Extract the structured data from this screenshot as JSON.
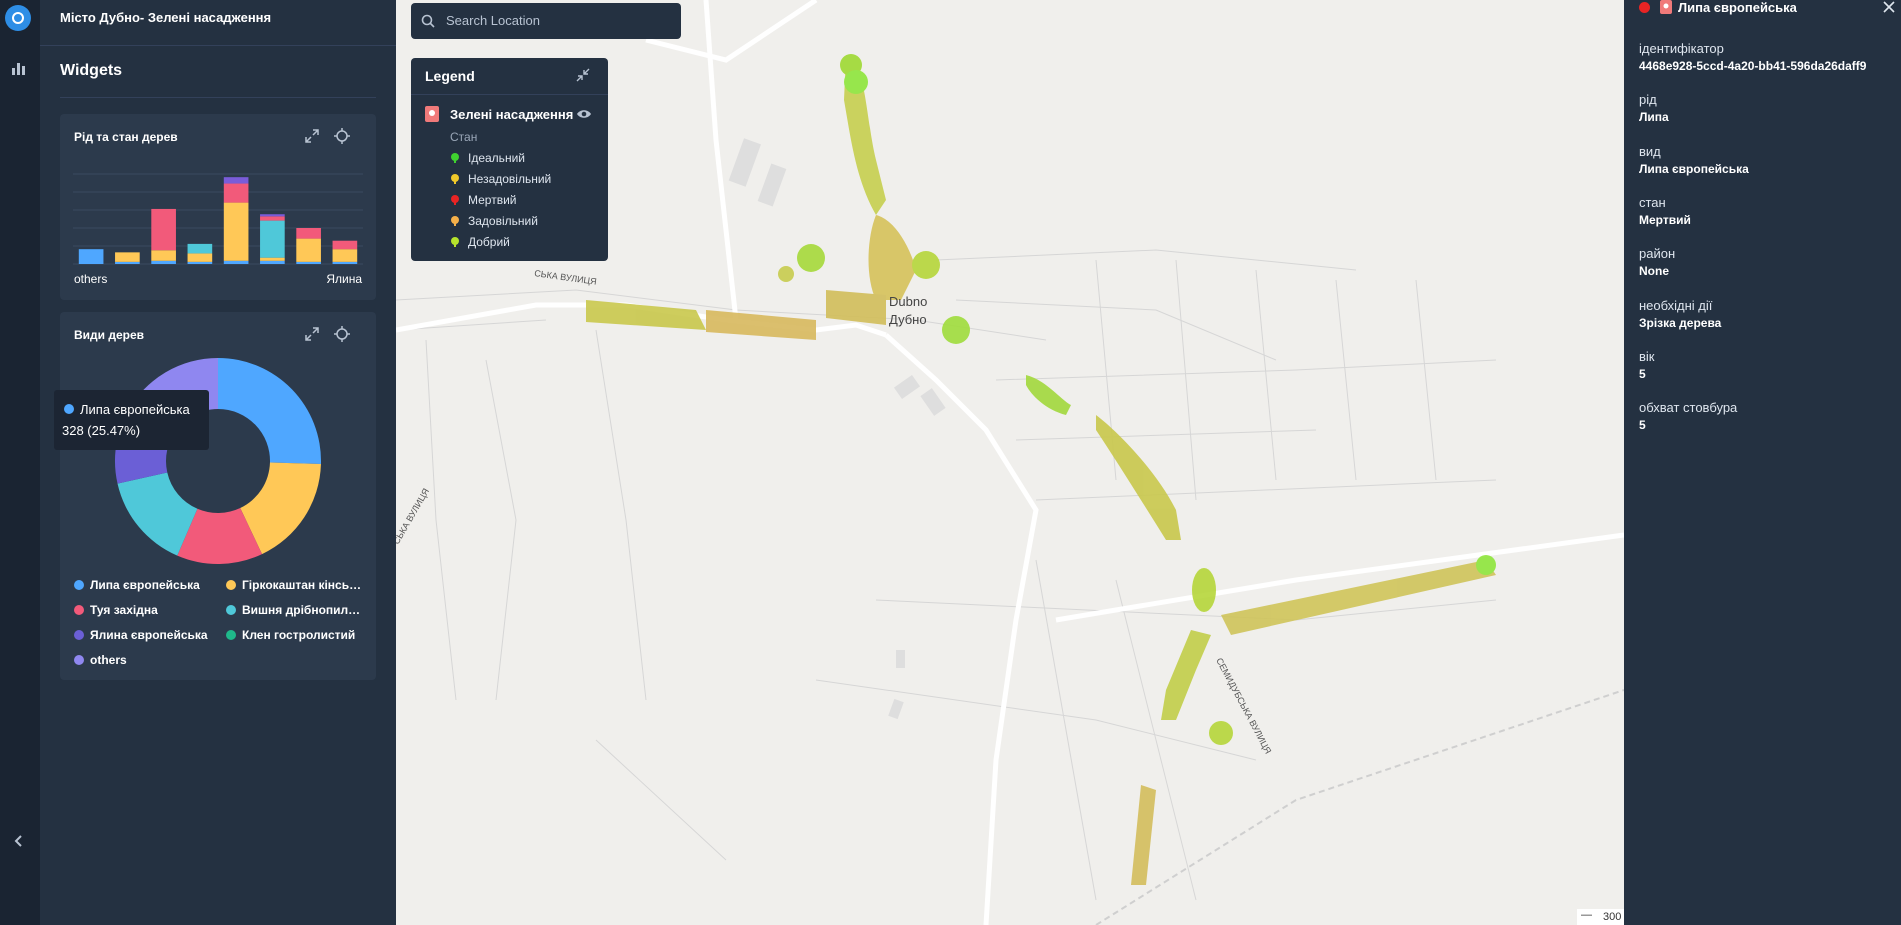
{
  "app": {
    "title": "Місто Дубно- Зелені насадження"
  },
  "sidebar": {
    "widgets_title": "Widgets"
  },
  "widget_genus": {
    "title": "Рід та стан дерев",
    "axis_left": "others",
    "axis_right": "Ялина",
    "colors": {
      "blue": "#4fa7ff",
      "yellow": "#ffc857",
      "pink": "#f25a7a",
      "teal": "#4fc8d9",
      "purple": "#7a5cd9"
    },
    "chart_data": {
      "type": "bar",
      "stacked": true,
      "categories": [
        "others",
        "",
        "",
        "",
        "",
        "",
        "",
        "Ялина"
      ],
      "series": [
        {
          "color": "#4fa7ff",
          "values": [
            14,
            2,
            3,
            2,
            3,
            3,
            2,
            2
          ]
        },
        {
          "color": "#ffc857",
          "values": [
            0,
            9,
            10,
            8,
            55,
            3,
            22,
            12
          ]
        },
        {
          "color": "#4fc8d9",
          "values": [
            0,
            0,
            0,
            9,
            0,
            35,
            0,
            0
          ]
        },
        {
          "color": "#f25a7a",
          "values": [
            0,
            0,
            39,
            0,
            18,
            4,
            10,
            8
          ]
        },
        {
          "color": "#7a5cd9",
          "values": [
            0,
            0,
            0,
            0,
            6,
            2,
            0,
            0
          ]
        }
      ],
      "ylim": [
        0,
        85
      ],
      "grid": true
    }
  },
  "widget_species": {
    "title": "Види дерев",
    "tooltip": {
      "name": "Липа європейська",
      "value": "328 (25.47%)"
    },
    "legend": [
      {
        "label": "Липа європейська",
        "color": "#4fa7ff"
      },
      {
        "label": "Гіркокаштан кінськ...",
        "color": "#ffc857"
      },
      {
        "label": "Туя західна",
        "color": "#f25a7a"
      },
      {
        "label": "Вишня дрібнопиль...",
        "color": "#4fc8d9"
      },
      {
        "label": "Ялина європейська",
        "color": "#6b5fd6"
      },
      {
        "label": "Клен гостролистий",
        "color": "#1fb88a"
      },
      {
        "label": "others",
        "color": "#8f87f0"
      }
    ],
    "chart_data": {
      "type": "pie",
      "donut": true,
      "labels": [
        "Липа європейська",
        "Гіркокаштан кінськ...",
        "Туя західна",
        "Вишня дрібнопиль...",
        "Ялина європейська",
        "Клен гостролистий",
        "others"
      ],
      "values": [
        25.47,
        17.5,
        13.5,
        15.0,
        7.0,
        4.5,
        17.03
      ],
      "colors": [
        "#4fa7ff",
        "#ffc857",
        "#f25a7a",
        "#4fc8d9",
        "#6b5fd6",
        "#1fb88a",
        "#8f87f0"
      ]
    }
  },
  "search": {
    "placeholder": "Search Location"
  },
  "map_legend": {
    "title": "Legend",
    "layer": "Зелені насадження",
    "group": "Стан",
    "items": [
      {
        "label": "Ідеальний",
        "color": "#3fd12f"
      },
      {
        "label": "Незадовільний",
        "color": "#f0c92a"
      },
      {
        "label": "Мертвий",
        "color": "#e82424"
      },
      {
        "label": "Задовільний",
        "color": "#f5b04a"
      },
      {
        "label": "Добрий",
        "color": "#b6e32c"
      }
    ]
  },
  "map": {
    "city_label_latin": "Dubno",
    "city_label": "Дубно",
    "street_1": "СЬКА ВУЛИЦЯ",
    "street_2": "СЬКА ВУЛИЦЯ",
    "street_3": "СЕМИДУБСЬКА ВУЛИЦЯ",
    "scale": "300"
  },
  "detail": {
    "title": "Липа європейська",
    "status_color": "#e82424",
    "fields": [
      {
        "label": "ідентифікатор",
        "value": "4468e928-5ccd-4a20-bb41-596da26daff9"
      },
      {
        "label": "рід",
        "value": "Липа"
      },
      {
        "label": "вид",
        "value": "Липа європейська"
      },
      {
        "label": "стан",
        "value": "Мертвий"
      },
      {
        "label": "район",
        "value": "None"
      },
      {
        "label": "необхідні дії",
        "value": "Зрізка дерева"
      },
      {
        "label": "вік",
        "value": "5"
      },
      {
        "label": "обхват стовбура",
        "value": "5"
      }
    ]
  }
}
